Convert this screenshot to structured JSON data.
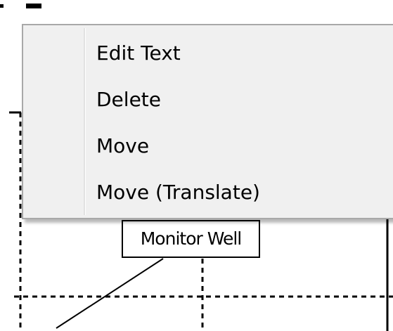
{
  "context_menu": {
    "items": [
      {
        "label": "Edit Text"
      },
      {
        "label": "Delete"
      },
      {
        "label": "Move"
      },
      {
        "label": "Move (Translate)"
      }
    ]
  },
  "callout": {
    "label": "Monitor Well"
  },
  "colors": {
    "menu_background": "#f0f0f0",
    "menu_border": "#a8a8a8",
    "line": "#000000"
  }
}
